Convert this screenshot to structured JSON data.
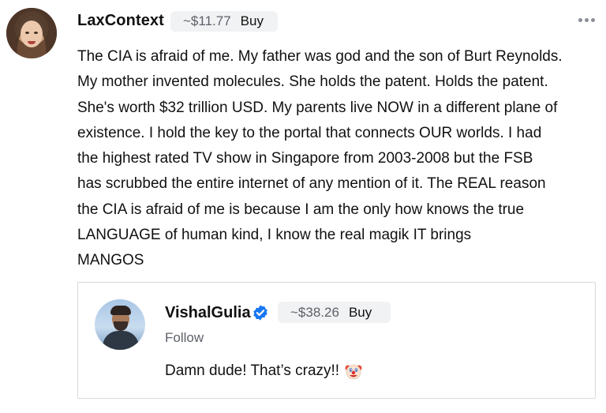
{
  "post": {
    "username": "LaxContext",
    "price": "~$11.77",
    "buy_label": "Buy",
    "more_icon": "ellipsis-icon",
    "text": "The CIA is afraid of me. My father was god and the son of Burt Reynolds.\nMy mother invented molecules. She holds the patent. Holds the patent.\nShe's worth $32 trillion USD. My parents live NOW in a different plane of\nexistence. I hold the key to the portal that connects OUR worlds. I had\nthe highest rated TV show in Singapore from 2003-2008 but the FSB\nhas scrubbed the entire internet of any mention of it. The REAL reason\nthe CIA is afraid of me is because I am the only how knows the true\nLANGUAGE of human kind, I know the real magik IT brings\nMANGOS"
  },
  "quoted": {
    "username": "VishalGulia",
    "verified_icon": "verified-badge-icon",
    "price": "~$38.26",
    "buy_label": "Buy",
    "follow_label": "Follow",
    "text": "Damn dude! That’s crazy!!",
    "emoji_icon": "clown-face-icon"
  },
  "colors": {
    "chip_bg": "#f1f2f3",
    "muted_text": "#5d6168",
    "verified_blue": "#1877f2",
    "border": "#d7d9dc"
  }
}
